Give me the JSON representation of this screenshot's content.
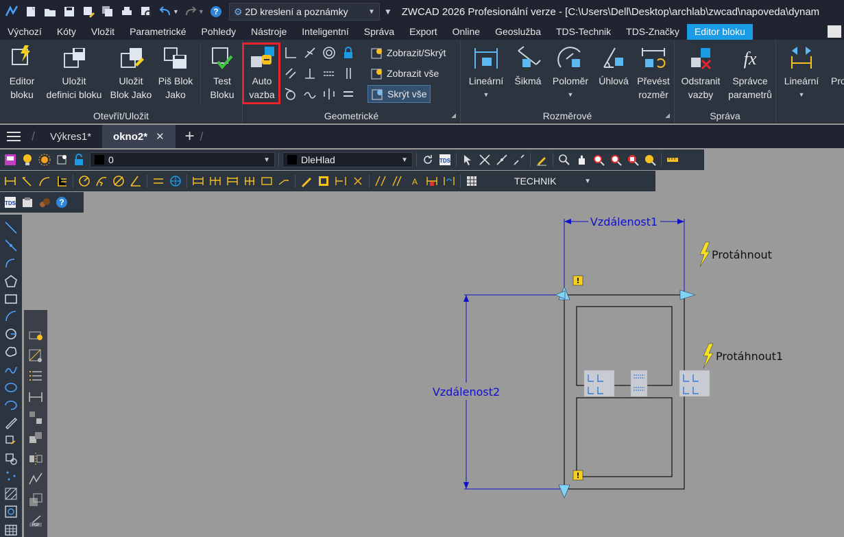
{
  "titlebar": {
    "workspace": "2D kreslení a poznámky",
    "title": "ZWCAD 2026 Profesionální verze - [C:\\Users\\Dell\\Desktop\\archlab\\zwcad\\napoveda\\dynam"
  },
  "menu": {
    "tabs": [
      "Výchozí",
      "Kóty",
      "Vložit",
      "Parametrické",
      "Pohledy",
      "Nástroje",
      "Inteligentní",
      "Správa",
      "Export",
      "Online",
      "Geoslužba",
      "TDS-Technik",
      "TDS-Značky",
      "Editor bloku"
    ],
    "active": "Editor bloku"
  },
  "ribbon": {
    "open_save": {
      "label": "Otevřít/Uložit",
      "editor_bloku_1": "Editor",
      "editor_bloku_2": "bloku",
      "ulozit_def_1": "Uložit",
      "ulozit_def_2": "definici bloku",
      "ulozit_jako_1": "Uložit",
      "ulozit_jako_2": "Blok Jako",
      "pis_blok_1": "Piš Blok",
      "pis_blok_2": "Jako",
      "test_1": "Test",
      "test_2": "Bloku"
    },
    "geometric": {
      "label": "Geometrické",
      "auto_1": "Auto",
      "auto_2": "vazba",
      "show_hide": "Zobrazit/Skrýt",
      "show_all": "Zobrazit vše",
      "hide_all": "Skrýt vše"
    },
    "dimensional": {
      "label": "Rozměrové",
      "linear": "Lineární",
      "aligned": "Šikmá",
      "radius": "Poloměr",
      "angular": "Úhlová",
      "convert_1": "Převést",
      "convert_2": "rozměr"
    },
    "manage": {
      "label": "Správa",
      "delete_1": "Odstranit",
      "delete_2": "vazby",
      "params_1": "Správce",
      "params_2": "parametrů"
    },
    "action": {
      "linear": "Lineární",
      "partial": "Pro"
    }
  },
  "doctabs": {
    "tabs": [
      "Výkres1*",
      "okno2*"
    ],
    "active": "okno2*"
  },
  "toolbar": {
    "layer_value": "0",
    "color_value": "DleHlad",
    "style_value": "TECHNIK"
  },
  "canvas": {
    "param_top": "Vzdálenost1",
    "param_left": "Vzdálenost2",
    "action_1": "Protáhnout",
    "action_2": "Protáhnout1",
    "warn": "!"
  },
  "colors": {
    "accent": "#1b9ae6",
    "param": "#1010c8",
    "grip": "#7fd4f0",
    "highlight_box": "#e8232b"
  }
}
